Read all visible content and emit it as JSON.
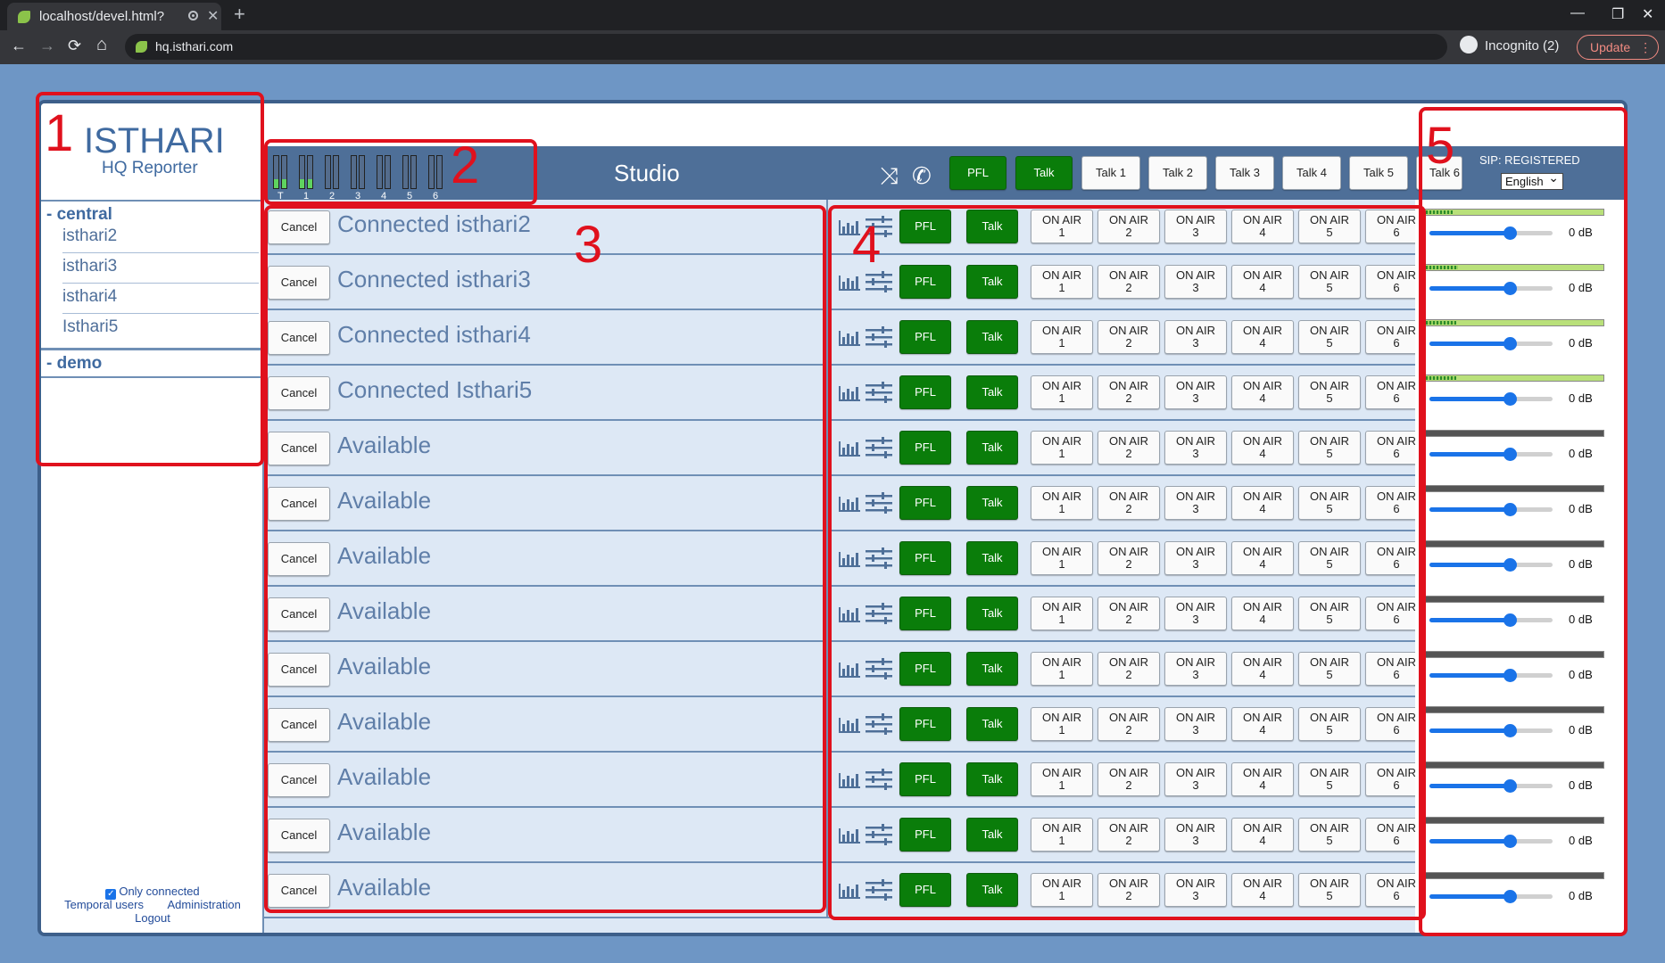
{
  "browser": {
    "tab_title": "localhost/devel.html?",
    "tab_close": "✕",
    "new_tab": "+",
    "back": "←",
    "forward": "→",
    "reload": "⟳",
    "home": "⌂",
    "url": "hq.isthari.com",
    "incognito": "Incognito (2)",
    "update": "Update",
    "update_menu": "⋮",
    "minimize": "—",
    "restore": "❐",
    "close": "✕"
  },
  "sidebar": {
    "title": "ISTHARI",
    "subtitle": "HQ Reporter",
    "groups": [
      {
        "label": "- central",
        "items": [
          "isthari2",
          "isthari3",
          "isthari4",
          "Isthari5"
        ]
      },
      {
        "label": "- demo",
        "items": []
      }
    ],
    "only_connected": "Only connected",
    "check_mark": "✓",
    "temporal_users": "Temporal users",
    "administration": "Administration",
    "logout": "Logout"
  },
  "header": {
    "vu_labels": [
      "T",
      "1",
      "2",
      "3",
      "4",
      "5",
      "6"
    ],
    "studio": "Studio",
    "shuffle_icon": "⤨",
    "phone_icon": "✆",
    "pfl": "PFL",
    "talk": "Talk",
    "talk_buttons": [
      "Talk 1",
      "Talk 2",
      "Talk 3",
      "Talk 4",
      "Talk 5",
      "Talk 6"
    ],
    "sip_status": "SIP: REGISTERED",
    "language": "English"
  },
  "rows": [
    {
      "cancel": "Cancel",
      "status": "Connected isthari2",
      "level": 0.15,
      "db": "0 dB"
    },
    {
      "cancel": "Cancel",
      "status": "Connected isthari3",
      "level": 0.18,
      "db": "0 dB"
    },
    {
      "cancel": "Cancel",
      "status": "Connected isthari4",
      "level": 0.17,
      "db": "0 dB"
    },
    {
      "cancel": "Cancel",
      "status": "Connected Isthari5",
      "level": 0.17,
      "db": "0 dB"
    },
    {
      "cancel": "Cancel",
      "status": "Available",
      "level": 0,
      "db": "0 dB"
    },
    {
      "cancel": "Cancel",
      "status": "Available",
      "level": 0,
      "db": "0 dB"
    },
    {
      "cancel": "Cancel",
      "status": "Available",
      "level": 0,
      "db": "0 dB"
    },
    {
      "cancel": "Cancel",
      "status": "Available",
      "level": 0,
      "db": "0 dB"
    },
    {
      "cancel": "Cancel",
      "status": "Available",
      "level": 0,
      "db": "0 dB"
    },
    {
      "cancel": "Cancel",
      "status": "Available",
      "level": 0,
      "db": "0 dB"
    },
    {
      "cancel": "Cancel",
      "status": "Available",
      "level": 0,
      "db": "0 dB"
    },
    {
      "cancel": "Cancel",
      "status": "Available",
      "level": 0,
      "db": "0 dB"
    },
    {
      "cancel": "Cancel",
      "status": "Available",
      "level": 0,
      "db": "0 dB"
    }
  ],
  "row_buttons": {
    "pfl": "PFL",
    "talk": "Talk",
    "on_air_line1": "ON AIR",
    "on_air_numbers": [
      "1",
      "2",
      "3",
      "4",
      "5",
      "6"
    ]
  },
  "volume": 0.65,
  "vu_lit": [
    1,
    1,
    0,
    0,
    0,
    0,
    0
  ],
  "annotations": [
    "1",
    "2",
    "3",
    "4",
    "5"
  ],
  "colors": {
    "accent_green": "#0a7d0a",
    "header_blue": "#4e6f98",
    "annotation_red": "#e0111d",
    "slider_blue": "#1a73e8"
  }
}
